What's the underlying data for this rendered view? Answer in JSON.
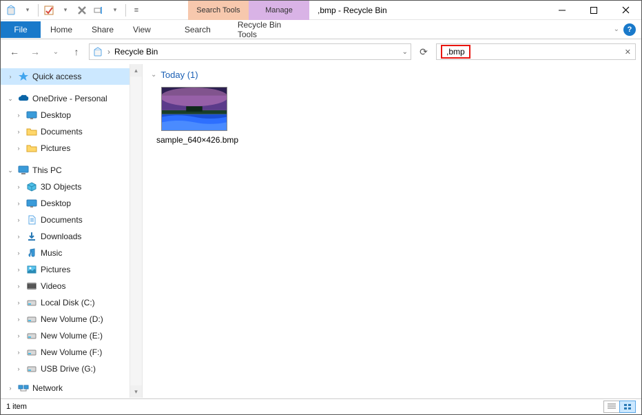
{
  "window": {
    "title": ",bmp - Recycle Bin",
    "context_tabs": {
      "search": "Search Tools",
      "manage": "Manage"
    },
    "ribbon": {
      "file": "File",
      "home": "Home",
      "share": "Share",
      "view": "View",
      "search_sub": "Search",
      "recycle_sub": "Recycle Bin Tools"
    }
  },
  "nav": {
    "location": "Recycle Bin",
    "chevron": "›",
    "search_value": ",bmp"
  },
  "sidebar": {
    "quick_access": "Quick access",
    "onedrive": "OneDrive - Personal",
    "od_items": [
      "Desktop",
      "Documents",
      "Pictures"
    ],
    "this_pc": "This PC",
    "pc_items": [
      "3D Objects",
      "Desktop",
      "Documents",
      "Downloads",
      "Music",
      "Pictures",
      "Videos",
      "Local Disk (C:)",
      "New Volume (D:)",
      "New Volume (E:)",
      "New Volume (F:)",
      "USB Drive (G:)"
    ],
    "network": "Network"
  },
  "content": {
    "group": "Today (1)",
    "files": [
      {
        "name": "sample_640×426.bmp"
      }
    ]
  },
  "status": {
    "count": "1 item"
  }
}
